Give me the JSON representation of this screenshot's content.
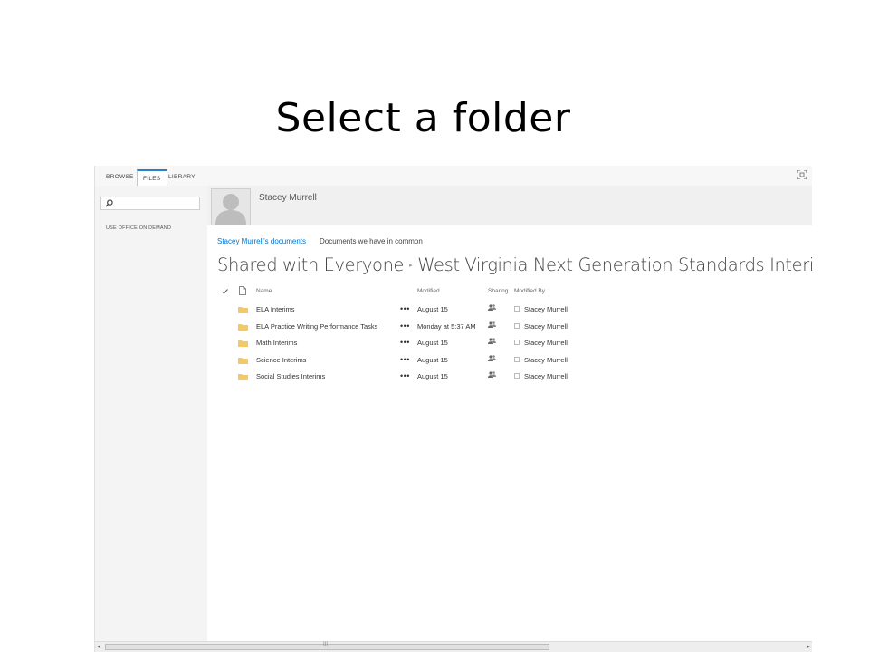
{
  "slide": {
    "title": "Select a folder"
  },
  "ribbon": {
    "tabs": [
      "BROWSE",
      "FILES",
      "LIBRARY"
    ],
    "active_tab": "FILES",
    "accent": "#2b7fc4"
  },
  "leftnav": {
    "search_placeholder": "",
    "office_on_demand": "USE OFFICE ON DEMAND"
  },
  "profile": {
    "name": "Stacey Murrell"
  },
  "doc_nav": {
    "my_documents": "Stacey Murrell's documents",
    "in_common": "Documents we have in common",
    "link_color": "#0072c6"
  },
  "breadcrumb": {
    "root": "Shared with Everyone",
    "current": "West Virginia Next Generation Standards Interi"
  },
  "table": {
    "headers": {
      "name": "Name",
      "modified": "Modified",
      "sharing": "Sharing",
      "modified_by": "Modified By"
    },
    "rows": [
      {
        "name": "ELA Interims",
        "modified": "August 15",
        "modified_by": "Stacey Murrell"
      },
      {
        "name": "ELA Practice Writing Performance Tasks",
        "modified": "Monday at 5:37 AM",
        "modified_by": "Stacey Murrell"
      },
      {
        "name": "Math Interims",
        "modified": "August 15",
        "modified_by": "Stacey Murrell"
      },
      {
        "name": "Science Interims",
        "modified": "August 15",
        "modified_by": "Stacey Murrell"
      },
      {
        "name": "Social Studies Interims",
        "modified": "August 15",
        "modified_by": "Stacey Murrell"
      }
    ],
    "ellipsis": "•••",
    "folder_color": "#f3c867"
  },
  "scrollbar": {
    "grip": "III",
    "left_arrow": "◂",
    "right_arrow": "▸"
  }
}
